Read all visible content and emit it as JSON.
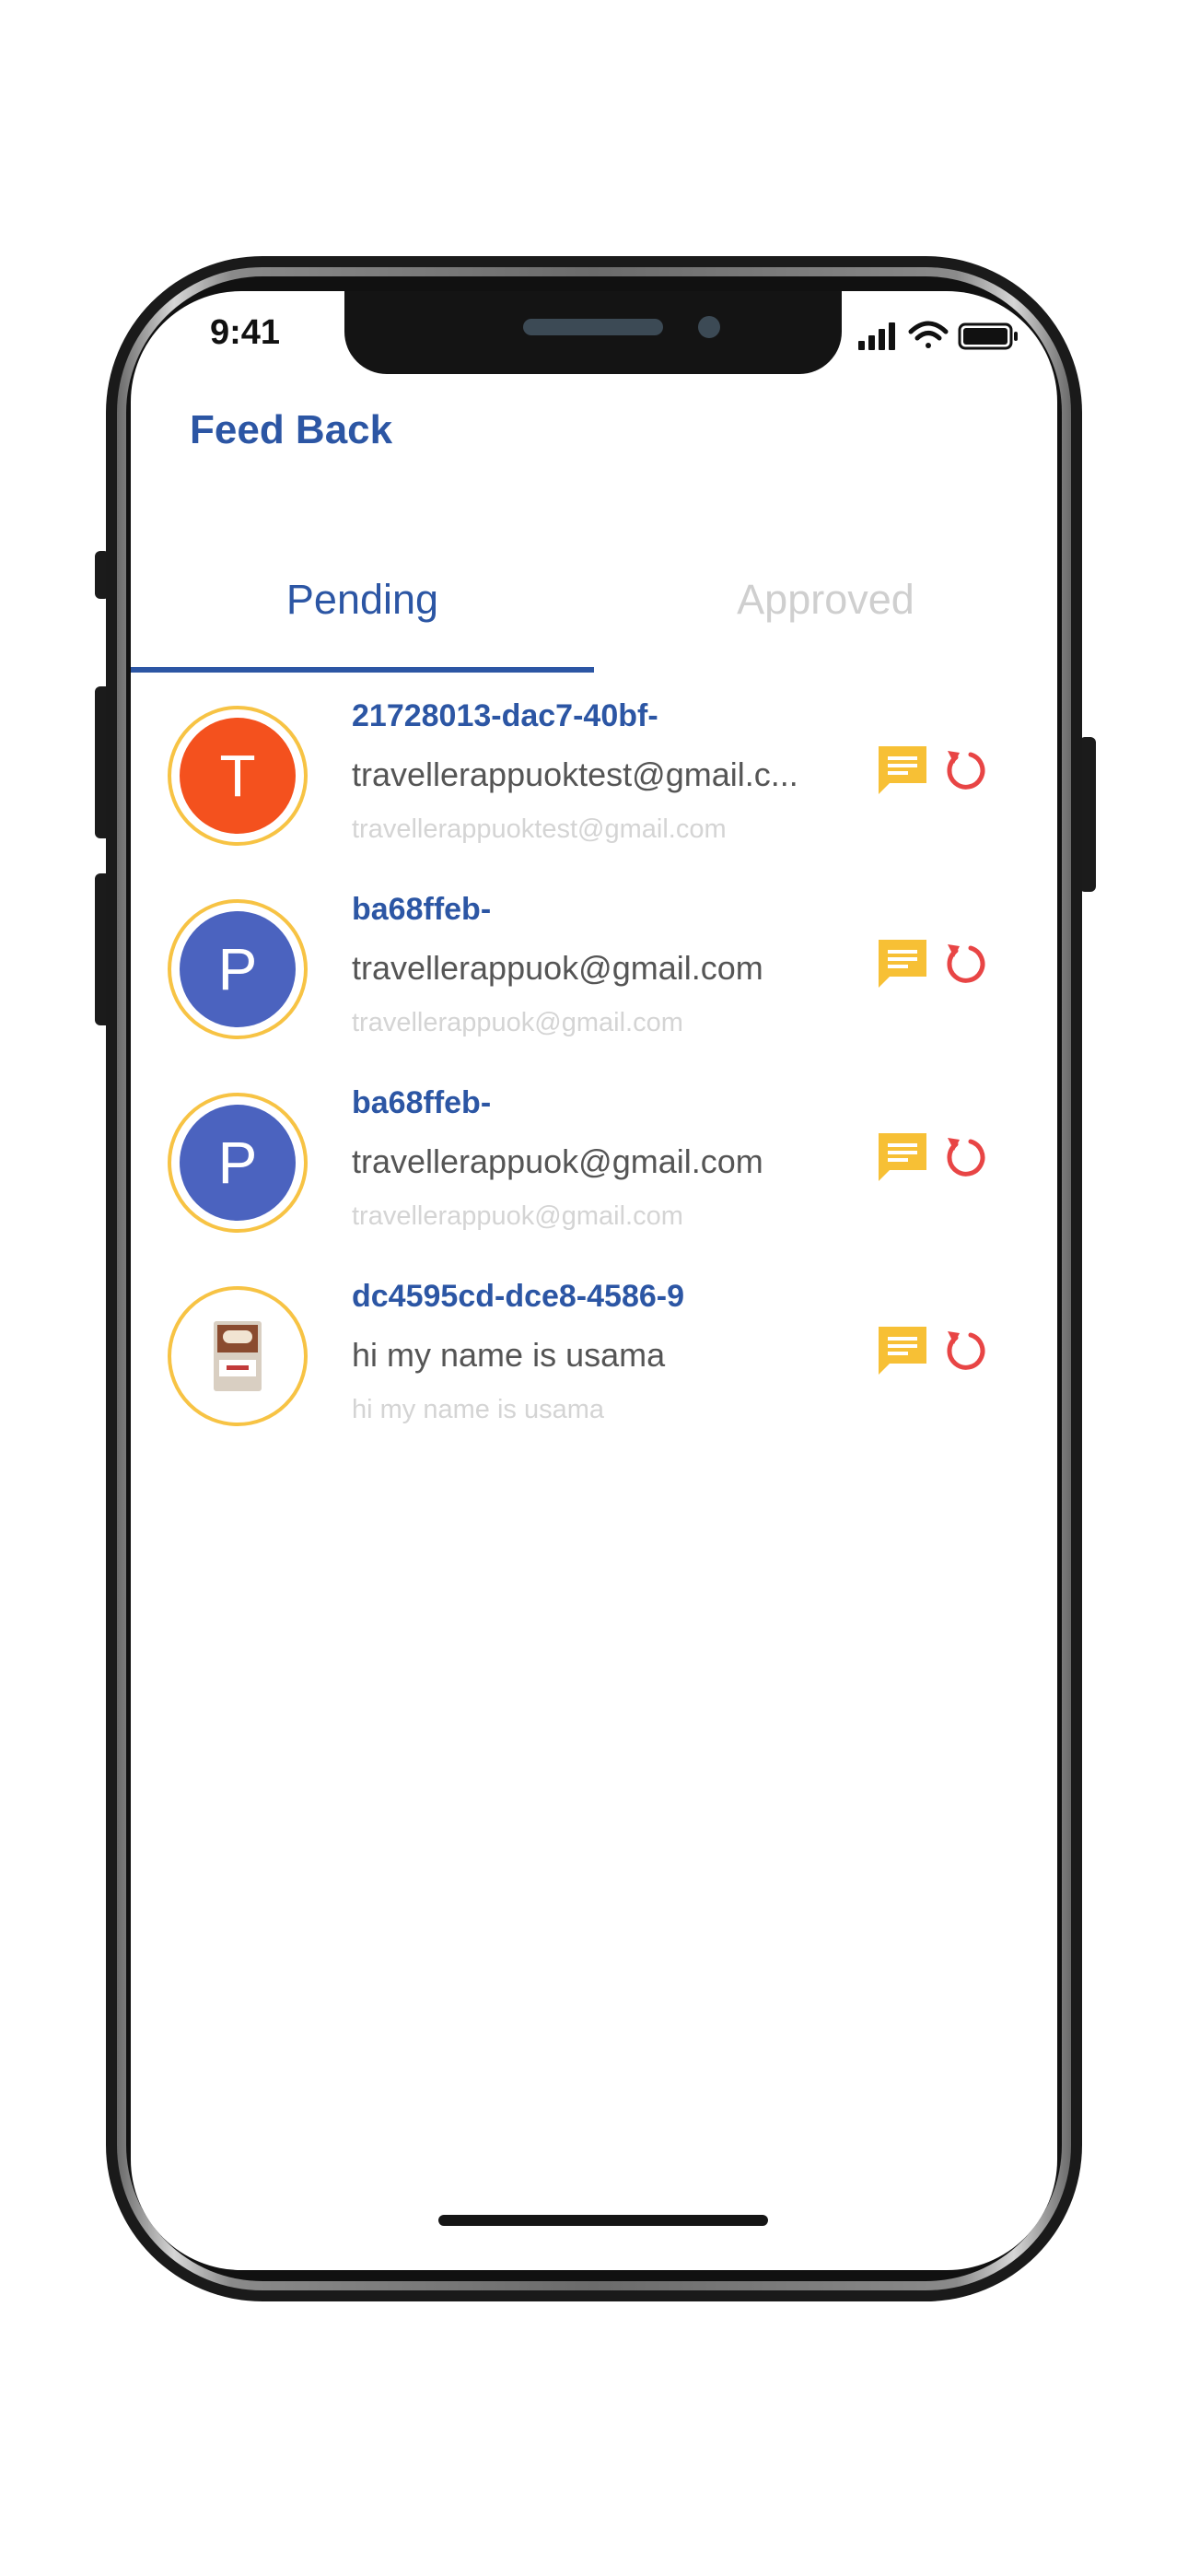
{
  "status": {
    "time": "9:41"
  },
  "header": {
    "title": "Feed Back"
  },
  "tabs": [
    {
      "label": "Pending",
      "active": true
    },
    {
      "label": "Approved",
      "active": false
    }
  ],
  "feedback": [
    {
      "avatar_letter": "T",
      "avatar_color": "#f4511e",
      "title": "21728013-dac7-40bf-",
      "subtitle": "travellerappuoktest@gmail.c...",
      "detail": "travellerappuoktest@gmail.com"
    },
    {
      "avatar_letter": "P",
      "avatar_color": "#4b63bf",
      "title": "ba68ffeb-",
      "subtitle": "travellerappuok@gmail.com",
      "detail": "travellerappuok@gmail.com"
    },
    {
      "avatar_letter": "P",
      "avatar_color": "#4b63bf",
      "title": "ba68ffeb-",
      "subtitle": "travellerappuok@gmail.com",
      "detail": "travellerappuok@gmail.com"
    },
    {
      "avatar_letter": "",
      "avatar_color": "#ffffff",
      "title": "dc4595cd-dce8-4586-9",
      "subtitle": "hi my name is usama",
      "detail": "hi my name is usama"
    }
  ],
  "icons": {
    "chat": "chat-bubble-icon",
    "reset": "refresh-icon"
  },
  "colors": {
    "accent": "#2c56a4",
    "chat_icon": "#f7c035",
    "reset_icon": "#e84545",
    "avatar_ring": "#f7c344"
  }
}
